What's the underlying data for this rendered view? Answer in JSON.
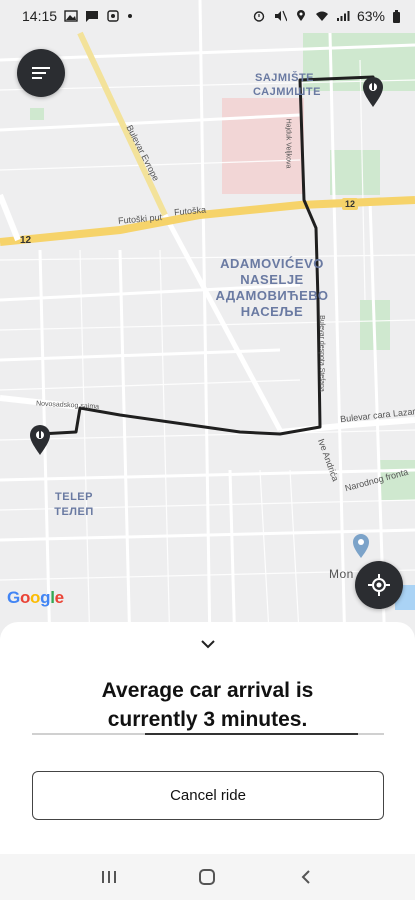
{
  "status_bar": {
    "time": "14:15",
    "battery": "63%"
  },
  "map": {
    "labels": {
      "sajmiste_lat": "SAJMIŠTE",
      "sajmiste_cyr": "САЈМИШТЕ",
      "adamovicevo_lat_1": "ADAMOVIĆEVO",
      "adamovicevo_lat_2": "NASELJE",
      "adamovicevo_cyr_1": "АДАМОВИЋЕВО",
      "adamovicevo_cyr_2": "НАСЕЉЕ",
      "telep_lat": "TELEP",
      "telep_cyr": "ТЕЛЕП",
      "mon": "Mon"
    },
    "streets": {
      "bulevar_evrope": "Bulevar Evrope",
      "futoski_put": "Futoški put",
      "futoska": "Futoška",
      "bulevar_cara_lazara": "Bulevar cara Lazara",
      "narodnog_fronta": "Narodnog fronta",
      "ive_andrica": "Ive Andrića",
      "hajduk_veljkova": "Hajduk Veljkova",
      "bulevar_despota": "Bulevar despota Stefana",
      "novosadskog_sajma": "Novosadskog sajma"
    },
    "road_numbers": {
      "left": "12",
      "right": "12"
    },
    "google": "Google",
    "accent_route": "#1f1f1f"
  },
  "sheet": {
    "arrival_line_1": "Average car arrival is",
    "arrival_line_2": "currently 3 minutes.",
    "progress": 0.55,
    "cancel_label": "Cancel ride"
  }
}
